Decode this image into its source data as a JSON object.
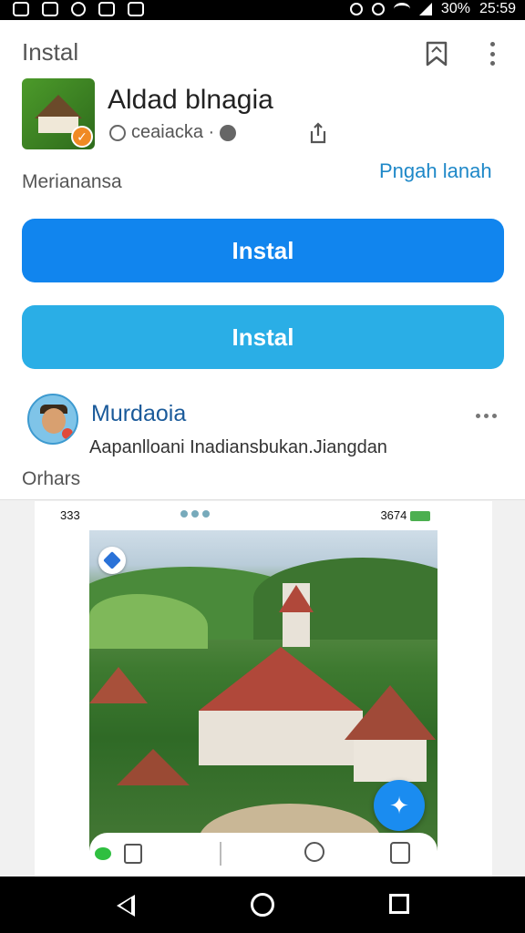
{
  "status_bar": {
    "battery": "30%",
    "time": "25:59"
  },
  "appbar": {
    "title": "Instal"
  },
  "app": {
    "name": "Aldad blnagia",
    "meta": "ceaiacka ·"
  },
  "links": {
    "left": "Merianansa",
    "right": "Pngah lanah"
  },
  "buttons": {
    "primary": "Instal",
    "secondary": "Instal"
  },
  "developer": {
    "name": "Murdaoia",
    "description": "Aapanlloani Inadiansbukan.Jiangdan"
  },
  "others_label": "Orhars",
  "screenshot": {
    "status_left": "333",
    "status_right": "3674"
  },
  "icons": [
    "bookmark-icon",
    "more-vert-icon",
    "share-icon",
    "info-icon",
    "fab-icon",
    "back-icon",
    "home-icon",
    "recents-icon"
  ],
  "colors": {
    "primary_button": "#1185ee",
    "secondary_button": "#2aaee6",
    "link": "#1e88c8"
  }
}
